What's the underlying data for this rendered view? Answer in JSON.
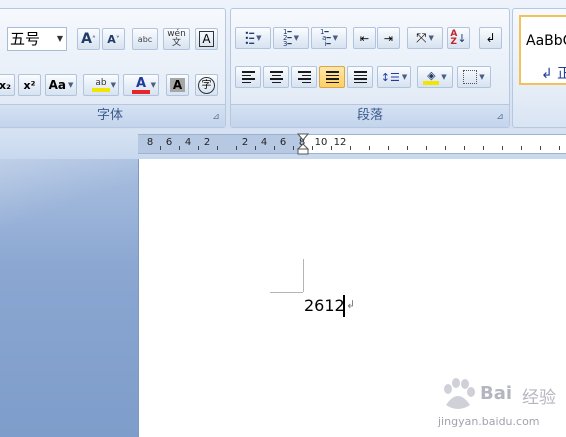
{
  "font_group": {
    "label": "字体",
    "font_size_value": "五号",
    "buttons": {
      "grow_font": "A",
      "shrink_font": "A",
      "clear_format": "abc",
      "phonetic_guide": "wén 文",
      "char_border": "A",
      "subscript": "x₂",
      "superscript": "x²",
      "change_case": "Aa",
      "highlight": "ab",
      "font_color": "A",
      "char_shading": "A",
      "enclose_char": "字"
    },
    "colors": {
      "highlight": "#f2e600",
      "font_color": "#e4262c"
    }
  },
  "paragraph_group": {
    "label": "段落"
  },
  "styles_group": {
    "sample_text": "AaBbC",
    "style_name": "↲ 正"
  },
  "ruler": {
    "labels": [
      "8",
      "6",
      "4",
      "2",
      "2",
      "4",
      "6",
      "8",
      "10",
      "12"
    ]
  },
  "document": {
    "text": "2612",
    "paragraph_mark": "↲"
  },
  "watermark": {
    "brand": "Bai",
    "brand_cn": "经验",
    "url": "jingyan.baidu.com"
  }
}
